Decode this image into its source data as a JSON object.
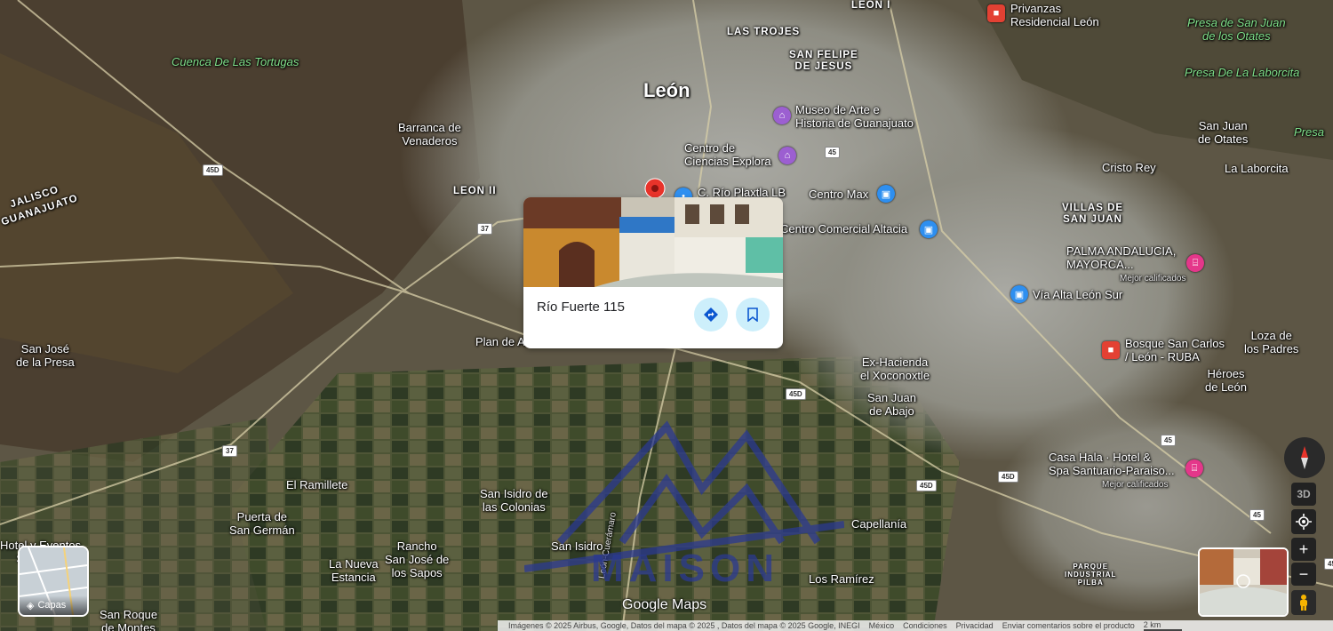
{
  "map": {
    "city_title": "León",
    "places": [
      {
        "text": "LAS TROJES",
        "cls": "caps"
      },
      {
        "text": "SAN FELIPE\nDE JESUS",
        "cls": "caps"
      },
      {
        "text": "LEON II",
        "cls": "caps"
      },
      {
        "text": "VILLAS DE\nSAN JUAN",
        "cls": "caps"
      },
      {
        "text": "Barranca de\nVenaderos",
        "cls": ""
      },
      {
        "text": "JALISCO",
        "cls": "caps rot"
      },
      {
        "text": "GUANAJUATO",
        "cls": "caps rot"
      },
      {
        "text": "San José\nde la Presa",
        "cls": ""
      },
      {
        "text": "Plan de A",
        "cls": ""
      },
      {
        "text": "Ex-Hacienda\nel Xoconoxtle",
        "cls": ""
      },
      {
        "text": "San Juan\nde Abajo",
        "cls": ""
      },
      {
        "text": "San Juan\nde Otates",
        "cls": ""
      },
      {
        "text": "Cristo Rey",
        "cls": ""
      },
      {
        "text": "La Laborcita",
        "cls": ""
      },
      {
        "text": "Loza de\nlos Padres",
        "cls": ""
      },
      {
        "text": "Héroes\nde León",
        "cls": ""
      },
      {
        "text": "El Ramillete",
        "cls": ""
      },
      {
        "text": "Puerta de\nSan Germán",
        "cls": ""
      },
      {
        "text": "San Isidro de\nlas Colonias",
        "cls": ""
      },
      {
        "text": "San Isidro",
        "cls": ""
      },
      {
        "text": "Rancho\nSan José de\nlos Sapos",
        "cls": ""
      },
      {
        "text": "La Nueva\nEstancia",
        "cls": ""
      },
      {
        "text": "Capellanía",
        "cls": ""
      },
      {
        "text": "Los Ramírez",
        "cls": ""
      },
      {
        "text": "San Roque\nde Montes",
        "cls": ""
      },
      {
        "text": "PARQUE\nINDUSTRIAL\nPILBA",
        "cls": "tiny"
      },
      {
        "text": "Presa De La Laborcita",
        "cls": "green"
      },
      {
        "text": "Presa de San Juan\nde los Otates",
        "cls": "green"
      },
      {
        "text": "Presa",
        "cls": "green"
      },
      {
        "text": "Cuenca De Las Tortugas",
        "cls": "green"
      },
      {
        "text": "León-Cuerámaro",
        "cls": "sub"
      },
      {
        "text": "Hotel y Eventos\nSan José",
        "cls": ""
      },
      {
        "text": "LEON I",
        "cls": "caps"
      }
    ],
    "pois": [
      {
        "text": "Museo de Arte e\nHistoria de Guanajuato",
        "icon": "museum-icon",
        "kind": "purple",
        "glyph": "⌂"
      },
      {
        "text": "Centro de\nCiencias Explora",
        "icon": "museum-icon",
        "kind": "purple",
        "glyph": "⌂"
      },
      {
        "text": "Centro Max",
        "icon": "shopping-icon",
        "kind": "blue",
        "glyph": "▣"
      },
      {
        "text": "Centro Comercial Altacia",
        "icon": "shopping-icon",
        "kind": "blue",
        "glyph": "▣"
      },
      {
        "text": "Vía Alta León Sur",
        "icon": "shopping-icon",
        "kind": "blue",
        "glyph": "▣"
      },
      {
        "text": "C. Río Plaxtla LB",
        "icon": "transit-icon",
        "kind": "blue",
        "glyph": "•"
      },
      {
        "text": "Privanzas\nResidencial León",
        "icon": "residential-icon",
        "kind": "red",
        "glyph": "■"
      },
      {
        "text": "Bosque San Carlos\n/ León - RUBA",
        "icon": "residential-icon",
        "kind": "red",
        "glyph": "■"
      },
      {
        "text": "PALMA ANDALUCIA,\nMAYORCA...",
        "sub": "Mejor calificados",
        "icon": "hotel-icon",
        "kind": "pink",
        "glyph": "⌸"
      },
      {
        "text": "Casa Hala · Hotel &\nSpa Santuario-Paraiso...",
        "sub": "Mejor calificados",
        "icon": "hotel-icon",
        "kind": "pink",
        "glyph": "⌸"
      }
    ],
    "shields": [
      "45D",
      "37",
      "45",
      "45D",
      "45",
      "37",
      "45D",
      "45D",
      "45",
      "45"
    ]
  },
  "card": {
    "address": "Río Fuerte 115",
    "directions_icon": "directions-icon",
    "save_icon": "bookmark-icon"
  },
  "controls": {
    "layers_label": "Capas",
    "three_d": "3D",
    "zoom_in": "+",
    "zoom_out": "−"
  },
  "footer": {
    "attribution": "Imágenes © 2025 Airbus, Google, Datos del mapa © 2025 , Datos del mapa © 2025 Google, INEGI",
    "country": "México",
    "terms": "Condiciones",
    "privacy": "Privacidad",
    "feedback": "Enviar comentarios sobre el producto",
    "scale": "2 km"
  },
  "brand": {
    "google_maps": "Google Maps",
    "watermark": "MAISON"
  },
  "colors": {
    "pin": "#e8332a",
    "card_button_bg": "#cdeffb",
    "card_button_icon": "#0b57d0"
  }
}
